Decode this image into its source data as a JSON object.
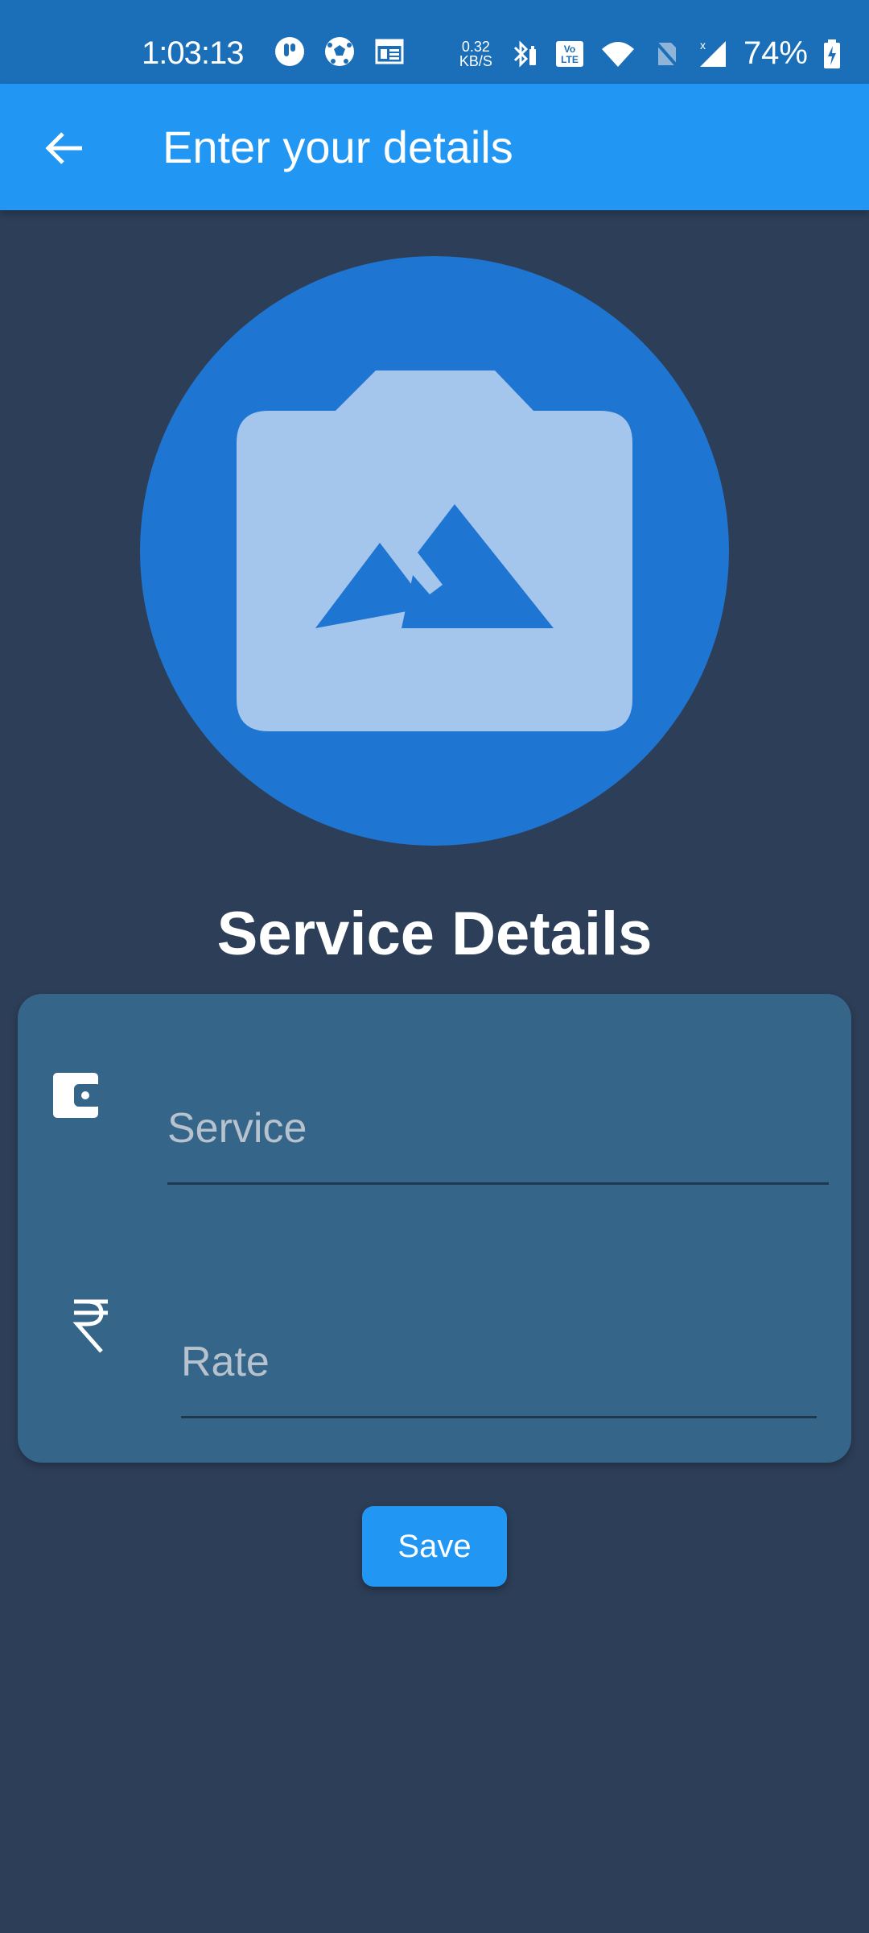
{
  "status_bar": {
    "time": "1:03:13",
    "net_speed_value": "0.32",
    "net_speed_unit": "KB/S",
    "battery_percent": "74%",
    "icons": [
      "notification-icon",
      "soccer-ball-icon",
      "news-icon",
      "bluetooth-icon",
      "volte-icon",
      "wifi-icon",
      "no-sim-icon",
      "signal-icon",
      "battery-charging-icon"
    ]
  },
  "app_bar": {
    "title": "Enter your details",
    "back_icon": "arrow-back-icon"
  },
  "avatar": {
    "icon": "camera-image-icon"
  },
  "section": {
    "title": "Service Details"
  },
  "form": {
    "service": {
      "icon": "wallet-icon",
      "placeholder": "Service",
      "value": ""
    },
    "rate": {
      "icon": "rupee-icon",
      "placeholder": "Rate",
      "value": ""
    }
  },
  "actions": {
    "save_label": "Save"
  },
  "colors": {
    "status_bar": "#1a6fb8",
    "app_bar": "#2196f3",
    "background": "#2d3e58",
    "card": "#356589",
    "avatar_circle": "#1f76d2",
    "avatar_icon": "#a4c6ec",
    "save_button": "#2196f3"
  }
}
